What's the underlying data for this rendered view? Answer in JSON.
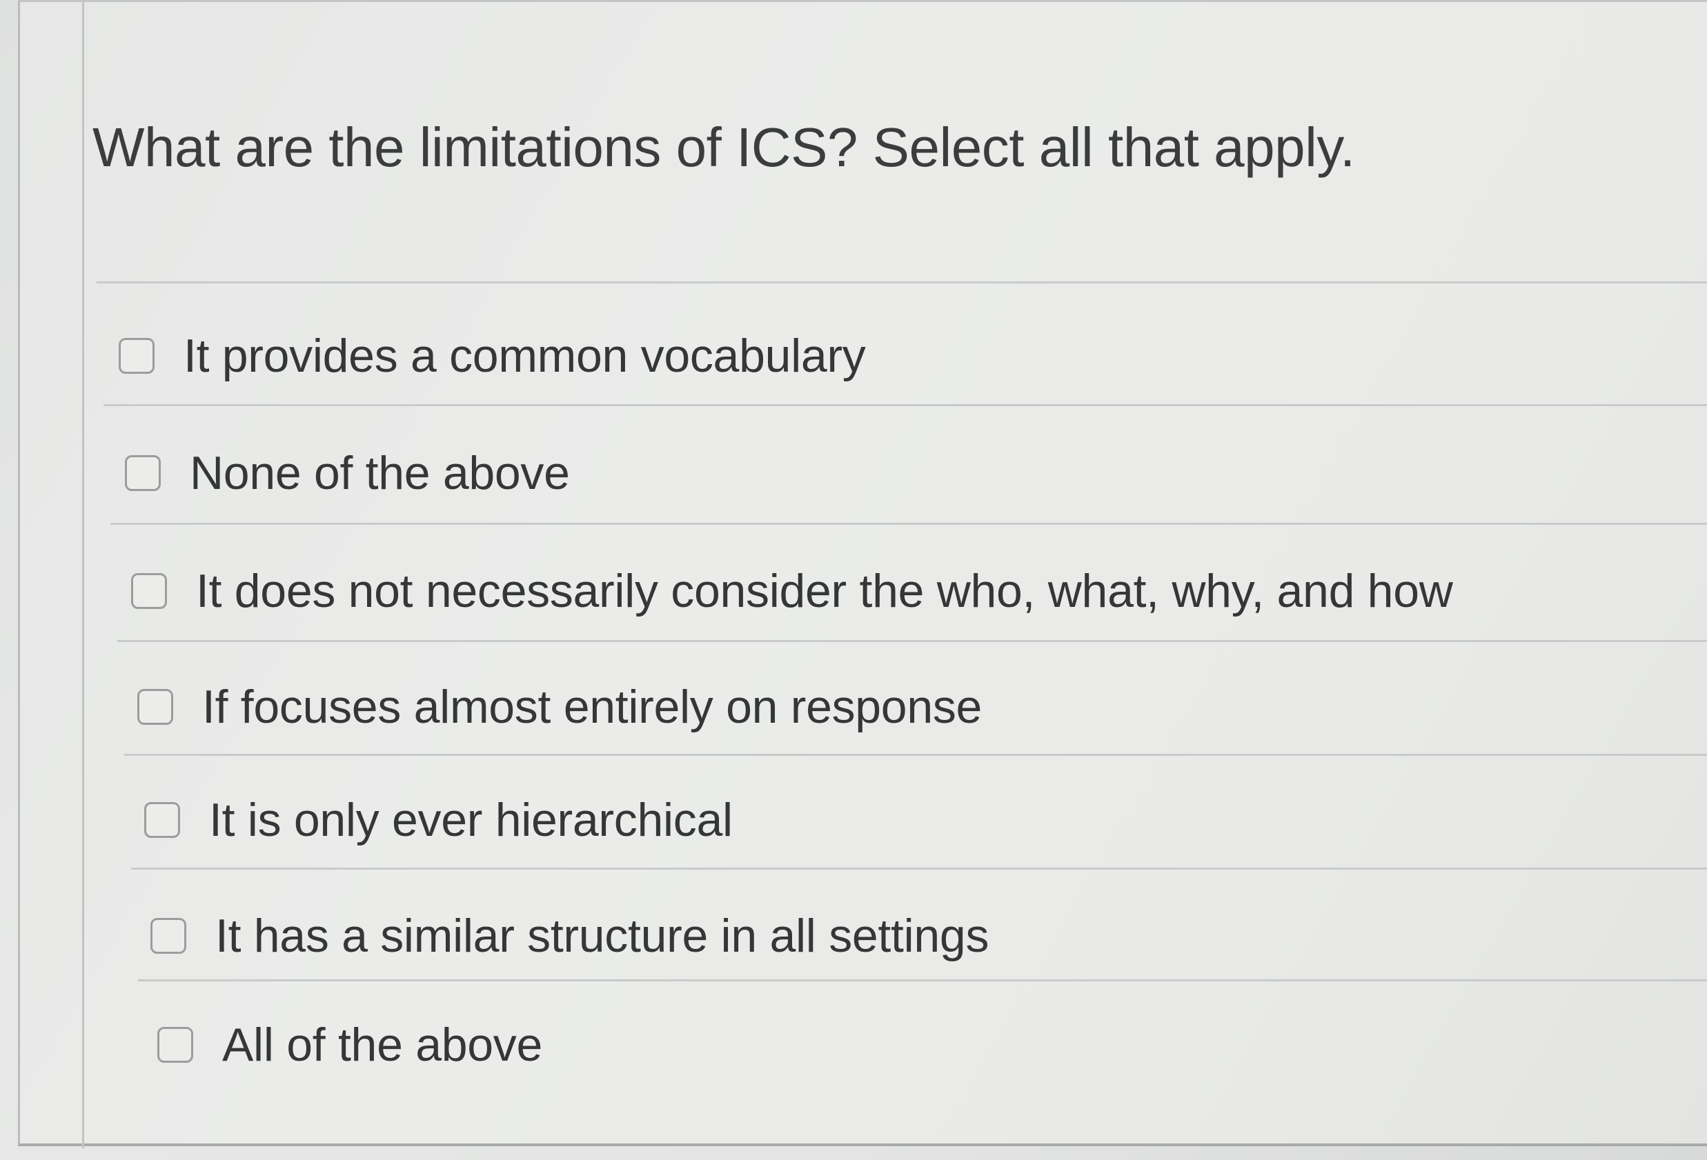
{
  "question": {
    "text": "What are the limitations of ICS? Select all that apply."
  },
  "options": [
    {
      "label": "It provides a common vocabulary",
      "checked": false
    },
    {
      "label": "None of the above",
      "checked": false
    },
    {
      "label": "It does not necessarily consider the who, what, why, and how",
      "checked": false
    },
    {
      "label": "If focuses almost entirely on response",
      "checked": false
    },
    {
      "label": "It is only ever hierarchical",
      "checked": false
    },
    {
      "label": "It has a similar structure in all settings",
      "checked": false
    },
    {
      "label": "All of the above",
      "checked": false
    }
  ],
  "colors": {
    "text": "#353637",
    "background": "#e8e9e7",
    "checkbox_border": "#9b9d9c",
    "divider": "#c9cbca"
  }
}
